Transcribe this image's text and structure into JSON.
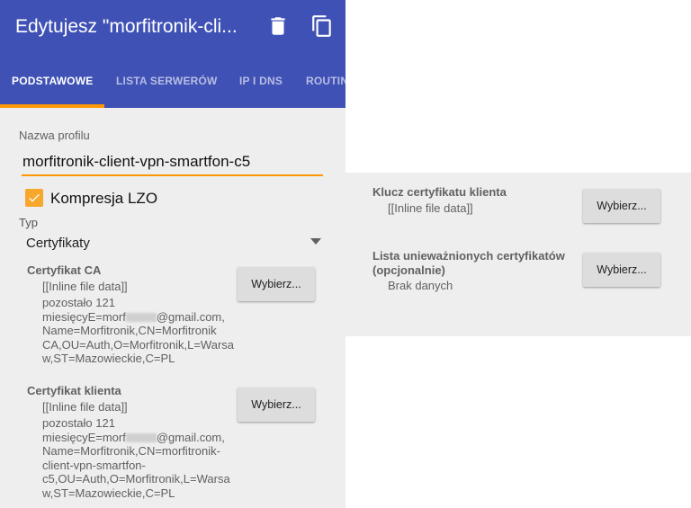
{
  "header": {
    "title": "Edytujesz \"morfitronik-cli...",
    "delete_icon": "trash-icon",
    "copy_icon": "copy-icon"
  },
  "tabs": [
    {
      "label": "PODSTAWOWE",
      "active": true
    },
    {
      "label": "LISTA SERWERÓW",
      "active": false
    },
    {
      "label": "IP I DNS",
      "active": false
    },
    {
      "label": "ROUTIN",
      "active": false
    }
  ],
  "colors": {
    "primary": "#3f51b5",
    "accent": "#ff9800",
    "background": "#eeeeee"
  },
  "profile": {
    "label": "Nazwa profilu",
    "value": "morfitronik-client-vpn-smartfon-c5"
  },
  "compression": {
    "label": "Kompresja LZO",
    "checked": true
  },
  "type": {
    "label": "Typ",
    "value": "Certyfikaty"
  },
  "ca_cert": {
    "title": "Certyfikat CA",
    "file": "[[Inline file data]]",
    "details_before": "pozostało 121\nmiesięcyE=morf",
    "details_after": "@gmail.com,\nName=Morfitronik,CN=Morfitronik\nCA,OU=Auth,O=Morfitronik,L=Warsa\nw,ST=Mazowieckie,C=PL",
    "button": "Wybierz..."
  },
  "client_cert": {
    "title": "Certyfikat klienta",
    "file": "[[Inline file data]]",
    "details_before": "pozostało 121\nmiesięcyE=morf",
    "details_after": "@gmail.com,\nName=Morfitronik,CN=morfitronik-\nclient-vpn-smartfon-\nc5,OU=Auth,O=Morfitronik,L=Warsa\nw,ST=Mazowieckie,C=PL",
    "button": "Wybierz..."
  },
  "client_key": {
    "title": "Klucz certyfikatu klienta",
    "file": "[[Inline file data]]",
    "button": "Wybierz..."
  },
  "crl": {
    "title": "Lista unieważnionych certyfikatów\n(opcjonalnie)",
    "value": "Brak danych",
    "button": "Wybierz..."
  }
}
